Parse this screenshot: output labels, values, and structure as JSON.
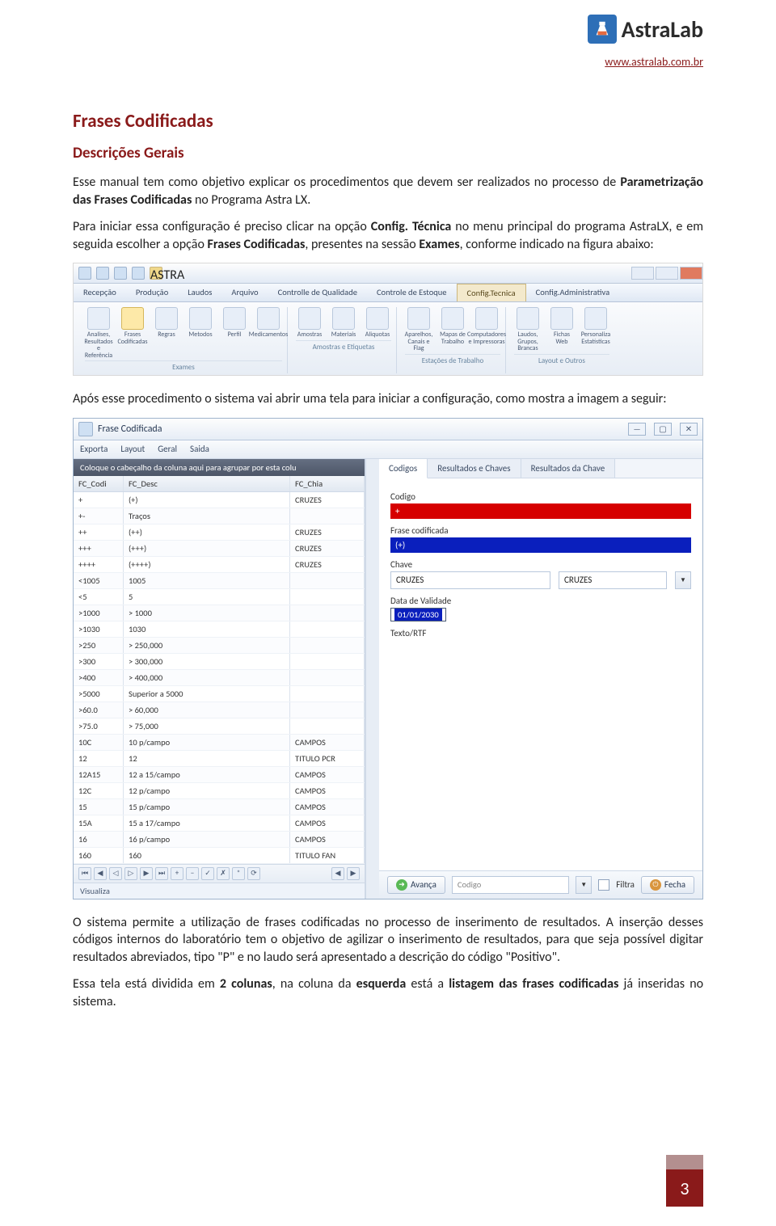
{
  "header": {
    "brand": "AstraLab",
    "site_link": "www.astralab.com.br"
  },
  "title": "Frases Codificadas",
  "subtitle": "Descrições Gerais",
  "para1_a": "Esse manual tem como objetivo explicar os procedimentos que devem ser realizados no processo de ",
  "para1_b": "Parametrização das Frases Codificadas",
  "para1_c": " no Programa Astra LX.",
  "para2_a": "Para iniciar essa configuração é preciso clicar na opção ",
  "para2_b": "Config. Técnica",
  "para2_c": " no menu principal do programa AstraLX, e em seguida escolher a opção ",
  "para2_d": "Frases Codificadas",
  "para2_e": ", presentes na sessão ",
  "para2_f": "Exames",
  "para2_g": ", conforme indicado na figura abaixo:",
  "ribbon": {
    "menu": [
      "Recepção",
      "Produção",
      "Laudos",
      "Arquivo",
      "Controlle de Qualidade",
      "Controle de Estoque",
      "Config.Tecnica",
      "Config.Administrativa"
    ],
    "groups": [
      {
        "name": "Exames",
        "icons": [
          {
            "label": "Analises, Resultados e Referência"
          },
          {
            "label": "Frases Codificadas",
            "active": true
          },
          {
            "label": "Regras"
          },
          {
            "label": "Metodos"
          },
          {
            "label": "Perfil"
          },
          {
            "label": "Medicamentos"
          }
        ]
      },
      {
        "name": "Amostras e Etiquetas",
        "icons": [
          {
            "label": "Amostras"
          },
          {
            "label": "Materiais"
          },
          {
            "label": "Aliquotas"
          }
        ]
      },
      {
        "name": "Estações de Trabalho",
        "icons": [
          {
            "label": "Aparelhos, Canais e Flag"
          },
          {
            "label": "Mapas de Trabalho"
          },
          {
            "label": "Computadores e Impressoras"
          }
        ]
      },
      {
        "name": "Layout e Outros",
        "icons": [
          {
            "label": "Laudos, Grupos, Brancas"
          },
          {
            "label": "Fichas Web"
          },
          {
            "label": "Personaliza Estatísticas"
          }
        ]
      }
    ]
  },
  "para3": "Após esse procedimento o sistema vai abrir uma tela para iniciar a configuração, como mostra a imagem a seguir:",
  "window": {
    "title": "Frase Codificada",
    "menu": [
      "Exporta",
      "Layout",
      "Geral",
      "Saida"
    ],
    "group_hint": "Coloque o cabeçalho da coluna aqui para agrupar por esta colu",
    "columns": [
      "FC_Codi",
      "FC_Desc",
      "FC_Chia"
    ],
    "rows": [
      [
        "+",
        "(+)",
        "CRUZES"
      ],
      [
        "+-",
        "Traços",
        ""
      ],
      [
        "++",
        "(++)",
        "CRUZES"
      ],
      [
        "+++",
        "(+++)",
        "CRUZES"
      ],
      [
        "++++",
        "(++++)",
        "CRUZES"
      ],
      [
        "<1005",
        "1005",
        ""
      ],
      [
        "<5",
        "5",
        ""
      ],
      [
        ">1000",
        "> 1000",
        ""
      ],
      [
        ">1030",
        "1030",
        ""
      ],
      [
        ">250",
        "> 250,000",
        ""
      ],
      [
        ">300",
        "> 300,000",
        ""
      ],
      [
        ">400",
        "> 400,000",
        ""
      ],
      [
        ">5000",
        "Superior a 5000",
        ""
      ],
      [
        ">60.0",
        "> 60,000",
        ""
      ],
      [
        ">75.0",
        "> 75,000",
        ""
      ],
      [
        "10C",
        "10 p/campo",
        "CAMPOS"
      ],
      [
        "12",
        "12",
        "TITULO PCR"
      ],
      [
        "12A15",
        "12 a 15/campo",
        "CAMPOS"
      ],
      [
        "12C",
        "12 p/campo",
        "CAMPOS"
      ],
      [
        "15",
        "15 p/campo",
        "CAMPOS"
      ],
      [
        "15A",
        "15 a 17/campo",
        "CAMPOS"
      ],
      [
        "16",
        "16 p/campo",
        "CAMPOS"
      ],
      [
        "160",
        "160",
        "TITULO FAN"
      ]
    ],
    "status": "Visualiza",
    "right_tabs": [
      "Codigos",
      "Resultados e Chaves",
      "Resultados da Chave"
    ],
    "form": {
      "codigo_label": "Codigo",
      "codigo_val": "+",
      "frase_label": "Frase codificada",
      "frase_val": "(+)",
      "chave_label": "Chave",
      "chave_val": "CRUZES",
      "chave_sel": "CRUZES",
      "data_label": "Data de Validade",
      "data_val": "01/01/2030",
      "texto_label": "Texto/RTF"
    },
    "footer": {
      "avanca": "Avança",
      "search": "Codigo",
      "filtra": "Filtra",
      "fecha": "Fecha"
    }
  },
  "para4": "O sistema permite a utilização de frases codificadas no processo de inserimento de resultados. A inserção desses códigos internos do laboratório tem o objetivo de agilizar o inserimento de resultados, para que seja possível digitar resultados abreviados, tipo \"P\" e no laudo será apresentado a descrição do código \"Positivo\".",
  "para5_a": "Essa tela está dividida em ",
  "para5_b": "2 colunas",
  "para5_c": ", na coluna da ",
  "para5_d": "esquerda",
  "para5_e": " está a ",
  "para5_f": "listagem das frases codificadas",
  "para5_g": " já inseridas no sistema.",
  "page_number": "3"
}
